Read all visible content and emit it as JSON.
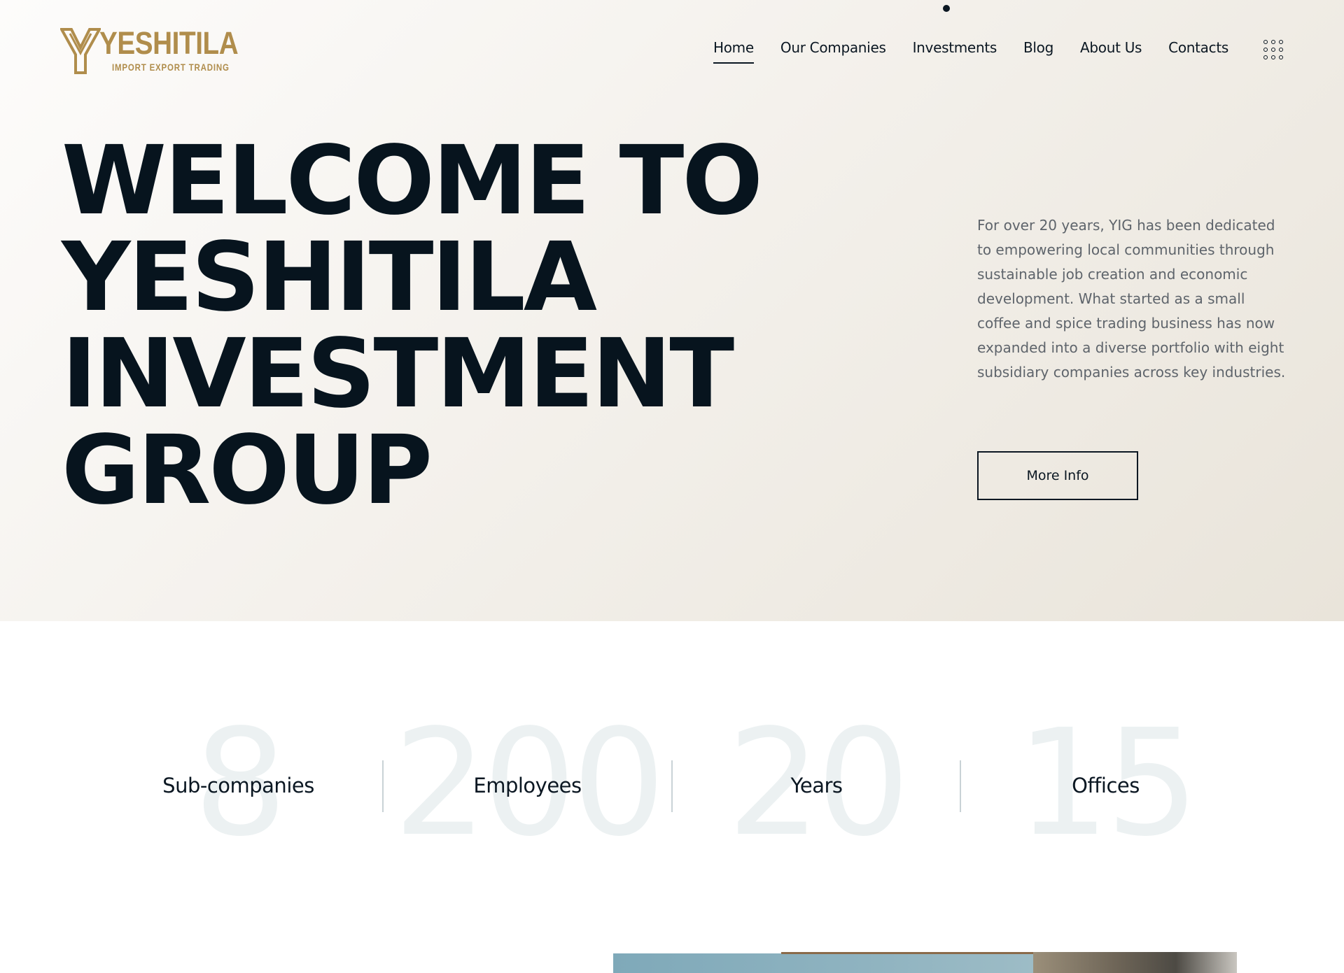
{
  "brand": {
    "name": "YESHITILA",
    "tagline": "IMPORT EXPORT TRADING",
    "color": "#b08d4c"
  },
  "nav": {
    "items": [
      {
        "label": "Home",
        "active": true
      },
      {
        "label": "Our Companies",
        "active": false
      },
      {
        "label": "Investments",
        "active": false
      },
      {
        "label": "Blog",
        "active": false
      },
      {
        "label": "About Us",
        "active": false
      },
      {
        "label": "Contacts",
        "active": false
      }
    ],
    "menu_icon": "grid-menu-icon"
  },
  "hero": {
    "headline_lines": [
      "WELCOME TO",
      "YESHITILA",
      "INVESTMENT",
      "GROUP"
    ],
    "intro": "For over 20 years, YIG has been dedicated to empowering local communities through sustainable job creation and economic development. What started as a small coffee and spice trading business has now expanded into a diverse portfolio with eight subsidiary companies across key industries.",
    "cta_label": "More Info"
  },
  "stats": [
    {
      "value": "8",
      "label": "Sub-companies"
    },
    {
      "value": "200",
      "label": "Employees"
    },
    {
      "value": "20",
      "label": "Years"
    },
    {
      "value": "15",
      "label": "Offices"
    }
  ]
}
